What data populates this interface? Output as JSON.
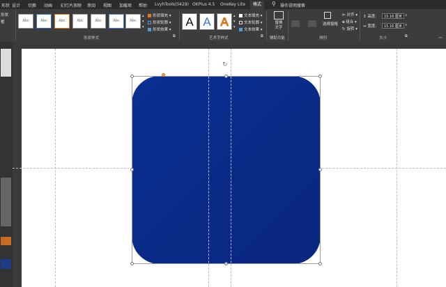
{
  "tabs": [
    "形状",
    "设计",
    "切换",
    "动画",
    "幻灯片放映",
    "审阅",
    "视图",
    "加载项",
    "帮助",
    "LvyhTools(0429)",
    "OKPlus 4.5",
    "OneKey Lite",
    "格式",
    "操作说明搜索"
  ],
  "left_clip": {
    "label1": "形状",
    "label2": "框"
  },
  "shape_styles": {
    "thumb_text": "Abc",
    "fill": "形状填充",
    "outline": "形状轮廓",
    "effects": "形状效果",
    "group": "形状样式"
  },
  "wordart": {
    "letter": "A",
    "text_fill": "文本填充",
    "text_outline": "文本轮廓",
    "text_effects": "文本效果",
    "group": "艺术字样式"
  },
  "accessibility": {
    "alt_text": "替换文字",
    "group": "辅助功能"
  },
  "arrange": {
    "selection_pane": "选择窗格",
    "align": "对齐",
    "group_obj": "组合",
    "rotate": "旋转",
    "group": "排列"
  },
  "size": {
    "height_label": "高度:",
    "height_value": "15.16 厘米",
    "width_label": "宽度:",
    "width_value": "15.16 厘米",
    "group": "大小"
  },
  "colors": {
    "shape_top": "#0b2e94",
    "shape_bottom": "#0a2780",
    "ribbon": "#3c3c3c",
    "tab_bar": "#2b2b2b",
    "accent": "#e07b20"
  }
}
